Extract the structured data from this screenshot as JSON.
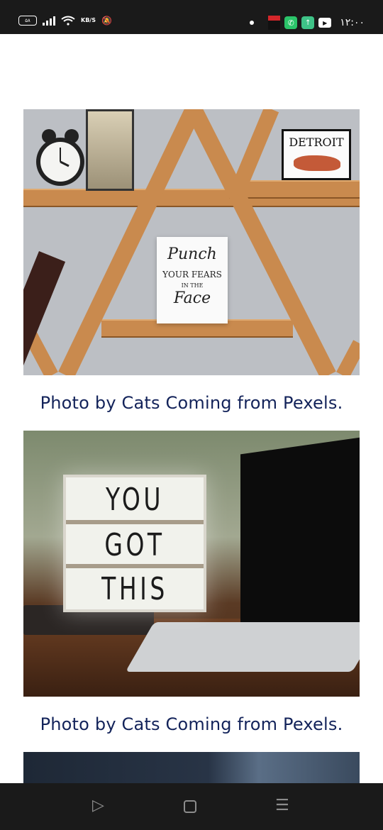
{
  "status_bar": {
    "battery_label": "۵۸",
    "network_speed": "KB/S",
    "time": "۱۲:۰۰",
    "icons": [
      "battery-icon",
      "signal-icon",
      "wifi-icon",
      "mute-icon",
      "dot-icon",
      "app-icon",
      "phone-icon",
      "upload-icon",
      "youtube-icon"
    ]
  },
  "articles": [
    {
      "photo_text": {
        "detroit": "DETROIT",
        "punch": "Punch",
        "your_fears": "YOUR FEARS",
        "in_the": "IN THE",
        "face": "Face"
      },
      "caption": "Photo by Cats Coming from Pexels."
    },
    {
      "photo_text": {
        "line1": "YOU",
        "line2": "GOT",
        "line3": "THIS"
      },
      "caption": "Photo by Cats Coming from Pexels."
    }
  ],
  "nav_bar": {
    "back_icon": "▷",
    "recent_icon": "☰"
  }
}
